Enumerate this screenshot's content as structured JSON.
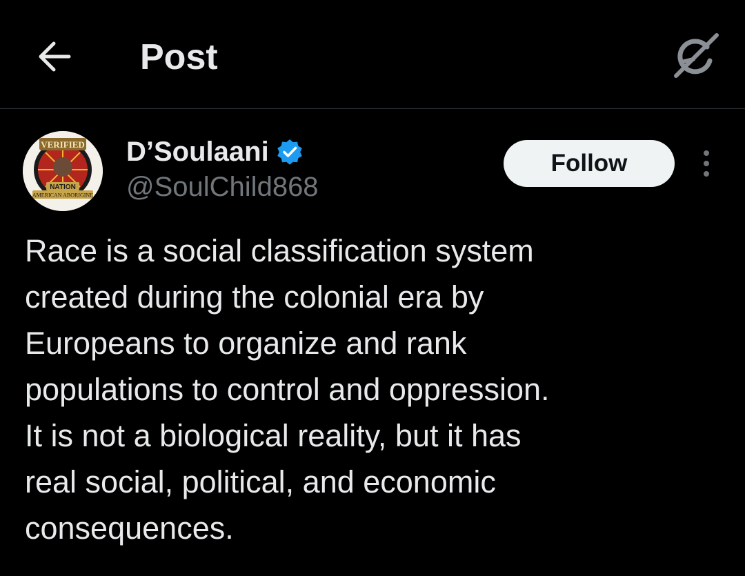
{
  "header": {
    "back_icon": "arrow-left-icon",
    "title": "Post",
    "grok_icon": "grok-icon"
  },
  "author": {
    "avatar_icon": "verified-nation-badge-avatar",
    "avatar_text_top": "VERIFIED",
    "avatar_text_mid": "NATION",
    "avatar_text_bottom": "AMERICAN ABORIGINE",
    "display_name": "D’Soulaani",
    "verified_icon": "verified-badge-icon",
    "handle": "@SoulChild868",
    "follow_label": "Follow",
    "more_icon": "more-vertical-icon"
  },
  "post": {
    "lines": [
      "Race is a social classification system",
      "created during the colonial era by",
      "Europeans to organize and rank",
      "populations to control and oppression.",
      "It is not a biological reality, but it has",
      "real social, political, and economic",
      "consequences."
    ]
  },
  "colors": {
    "background": "#000000",
    "text_primary": "#e7e9ea",
    "text_secondary": "#71767b",
    "verified_blue": "#1d9bf0",
    "follow_bg": "#eff3f4"
  }
}
